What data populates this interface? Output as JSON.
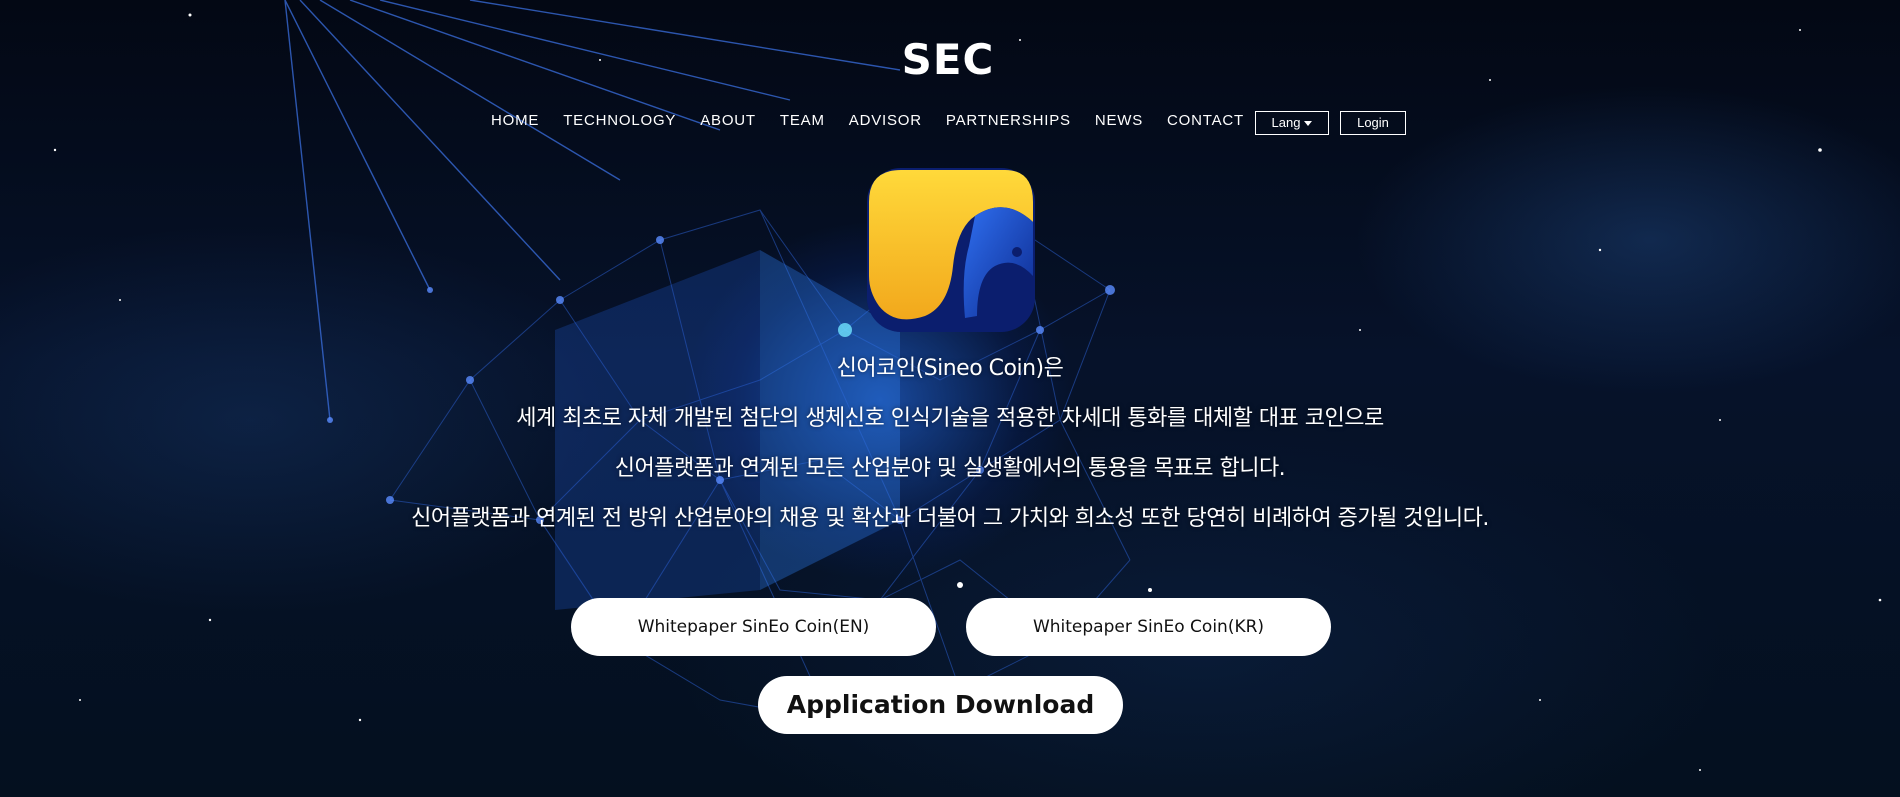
{
  "brand": {
    "logo_text": "SEC"
  },
  "nav": {
    "links": [
      "HOME",
      "TECHNOLOGY",
      "ABOUT",
      "TEAM",
      "ADVISOR",
      "PARTNERSHIPS",
      "NEWS",
      "CONTACT"
    ],
    "lang_label": "Lang",
    "login_label": "Login"
  },
  "hero": {
    "line0": "신어코인(Sineo Coin)은",
    "line1": "세계 최초로 자체 개발된 첨단의 생체신호 인식기술을 적용한 차세대 통화를 대체할 대표 코인으로",
    "line2": "신어플랫폼과 연계된 모든 산업분야 및 실생활에서의 통용을 목표로 합니다.",
    "line3": "신어플랫폼과 연계된 전 방위 산업분야의 채용 및 확산과 더불어 그 가치와 희소성 또한 당연히 비례하여 증가될 것입니다."
  },
  "buttons": {
    "whitepaper_en": "Whitepaper SinEo Coin(EN)",
    "whitepaper_kr": "Whitepaper SinEo Coin(KR)",
    "app_download": "Application Download"
  },
  "colors": {
    "accent_yellow": "#f7c52a",
    "accent_blue": "#1b3fb8",
    "bg": "#04101f"
  }
}
